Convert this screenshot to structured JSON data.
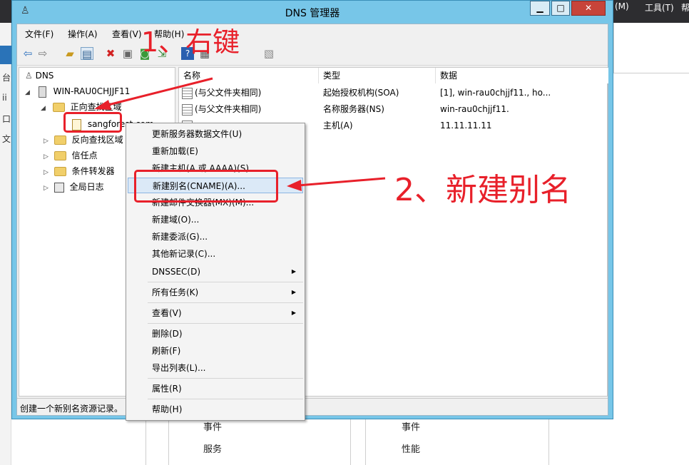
{
  "background": {
    "menu_manage": "(M)",
    "menu_tools": "工具(T)",
    "menu_help": "帮",
    "sidebar_glyphs": [
      "台",
      "ii",
      "口",
      "文"
    ],
    "panel_left": [
      "事件",
      "服务"
    ],
    "panel_right": [
      "事件",
      "性能"
    ]
  },
  "window": {
    "title": "DNS 管理器",
    "minimize": "▁",
    "maximize": "□",
    "close": "✕"
  },
  "menubar": [
    "文件(F)",
    "操作(A)",
    "查看(V)",
    "帮助(H)"
  ],
  "toolbar": {
    "icons": [
      "back-icon",
      "forward-icon",
      "up-folder-icon",
      "show-hide-tree-icon",
      "delete-icon",
      "properties-icon",
      "refresh-icon",
      "export-icon",
      "help-icon",
      "console-icon",
      "server-icon",
      "zone-icon"
    ]
  },
  "tree": {
    "root": "DNS",
    "server": "WIN-RAU0CHJJF11",
    "forward_zones": "正向查找区域",
    "zone": "sangforest.com",
    "reverse_zones": "反向查找区域",
    "trust_points": "信任点",
    "conditional_forwarders": "条件转发器",
    "global_logs": "全局日志"
  },
  "list": {
    "columns": [
      "名称",
      "类型",
      "数据"
    ],
    "rows": [
      {
        "name": "(与父文件夹相同)",
        "type": "起始授权机构(SOA)",
        "data": "[1], win-rau0chjjf11., ho..."
      },
      {
        "name": "(与父文件夹相同)",
        "type": "名称服务器(NS)",
        "data": "win-rau0chjjf11."
      },
      {
        "name": "",
        "type": "主机(A)",
        "data": "11.11.11.11"
      }
    ]
  },
  "status": "创建一个新别名资源记录。",
  "context_menu": {
    "items": [
      "更新服务器数据文件(U)",
      "重新加载(E)",
      "新建主机(A 或 AAAA)(S)...",
      "新建别名(CNAME)(A)...",
      "新建邮件交换器(MX)(M)...",
      "新建域(O)...",
      "新建委派(G)...",
      "其他新记录(C)...",
      "DNSSEC(D)",
      "所有任务(K)",
      "查看(V)",
      "删除(D)",
      "刷新(F)",
      "导出列表(L)...",
      "属性(R)",
      "帮助(H)"
    ],
    "submenu_arrow": "▶"
  },
  "annotations": {
    "step1": "1、右键",
    "step2": "2、新建别名",
    "color": "#e8202a"
  }
}
